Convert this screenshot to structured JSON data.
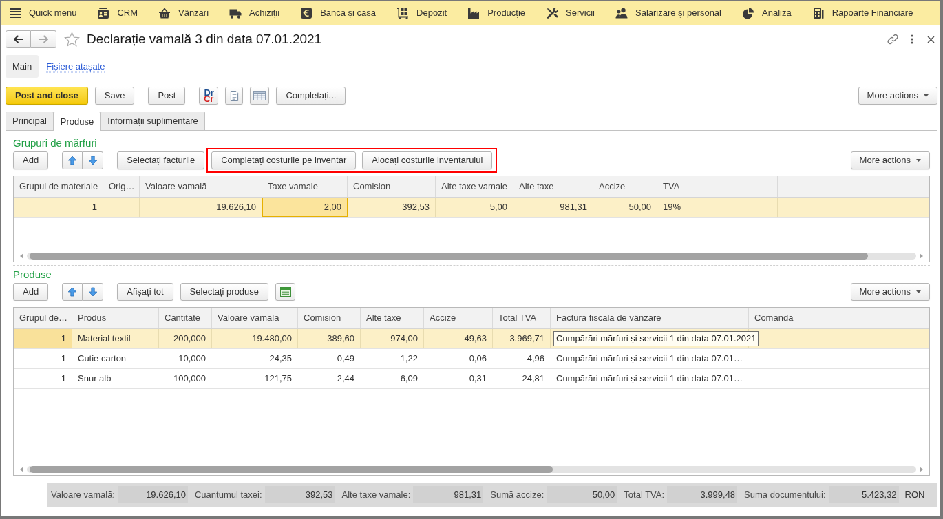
{
  "top_menu": [
    {
      "label": "Quick menu"
    },
    {
      "label": "CRM"
    },
    {
      "label": "Vânzări"
    },
    {
      "label": "Achiziții"
    },
    {
      "label": "Banca și casa"
    },
    {
      "label": "Depozit"
    },
    {
      "label": "Producție"
    },
    {
      "label": "Servicii"
    },
    {
      "label": "Salarizare și personal"
    },
    {
      "label": "Analiză"
    },
    {
      "label": "Rapoarte Financiare"
    }
  ],
  "navigation": [
    {
      "kind": "back",
      "disabled": false
    },
    {
      "kind": "forward",
      "disabled": true
    }
  ],
  "document": {
    "title": "Declarație vamală 3 din data 07.01.2021"
  },
  "view_tabs": [
    {
      "label": "Main",
      "selected": true
    },
    {
      "label": "Fișiere atașate",
      "selected": false
    }
  ],
  "command_bar": {
    "groups": [
      {
        "buttons": [
          {
            "kind": "primary",
            "label": "Post and close"
          },
          {
            "kind": "text",
            "label": "Save"
          }
        ]
      },
      {
        "buttons": [
          {
            "kind": "text",
            "label": "Post"
          }
        ]
      },
      {
        "buttons": [
          {
            "kind": "drcr",
            "lines": [
              "Dr",
              "Cr"
            ]
          },
          {
            "kind": "report"
          },
          {
            "kind": "grid"
          },
          {
            "kind": "text",
            "label": "Completați..."
          }
        ]
      }
    ],
    "more_actions": "More actions"
  },
  "form_tabs": [
    {
      "label": "Principal",
      "selected": false
    },
    {
      "label": "Produse",
      "selected": true
    },
    {
      "label": "Informații suplimentare",
      "selected": false
    }
  ],
  "goods_groups": {
    "heading": "Grupuri de mărfuri",
    "toolbar": {
      "groups": [
        {
          "buttons": [
            {
              "kind": "text",
              "label": "Add"
            }
          ]
        },
        {
          "buttons": [
            {
              "kind": "arrows"
            }
          ]
        },
        {
          "buttons": [
            {
              "kind": "text",
              "label": "Selectați facturile"
            }
          ],
          "highlighted_buttons": [
            {
              "kind": "text",
              "label": "Completați costurile pe inventar"
            },
            {
              "kind": "text",
              "label": "Alocați costurile inventarului"
            }
          ]
        }
      ],
      "more_actions": "More actions"
    },
    "table": {
      "has_focus": true,
      "columns": [
        {
          "label": "Grupul de materiale",
          "kind": "number"
        },
        {
          "label": "Orig…",
          "kind": "text"
        },
        {
          "label": "Valoare vamală",
          "kind": "number"
        },
        {
          "label": "Taxe vamale",
          "kind": "number"
        },
        {
          "label": "Comision",
          "kind": "number"
        },
        {
          "label": "Alte taxe vamale",
          "kind": "number"
        },
        {
          "label": "Alte taxe",
          "kind": "number"
        },
        {
          "label": "Accize",
          "kind": "number"
        },
        {
          "label": "TVA",
          "kind": "text"
        }
      ],
      "rows": [
        {
          "selected": true,
          "cells": [
            {
              "text": "1",
              "focused": false
            },
            {
              "focused": false
            },
            {
              "text": "19.626,10",
              "focused": false
            },
            {
              "text": "2,00",
              "focused": true
            },
            {
              "text": "392,53",
              "focused": false
            },
            {
              "text": "5,00",
              "focused": false
            },
            {
              "text": "981,31",
              "focused": false
            },
            {
              "text": "50,00",
              "focused": false
            },
            {
              "text": "19%",
              "focused": false
            }
          ]
        }
      ]
    }
  },
  "products": {
    "heading": "Produse",
    "toolbar": {
      "groups": [
        {
          "buttons": [
            {
              "kind": "text",
              "label": "Add"
            }
          ]
        },
        {
          "buttons": [
            {
              "kind": "arrows"
            }
          ]
        },
        {
          "buttons": [
            {
              "kind": "text",
              "label": "Afișați tot"
            },
            {
              "kind": "text",
              "label": "Selectați produse"
            },
            {
              "kind": "sheet"
            }
          ]
        }
      ],
      "more_actions": "More actions"
    },
    "table": {
      "has_focus": false,
      "columns": [
        {
          "label": "Grupul de…",
          "kind": "number"
        },
        {
          "label": "Produs",
          "kind": "text"
        },
        {
          "label": "Cantitate",
          "kind": "number"
        },
        {
          "label": "Valoare vamală",
          "kind": "number"
        },
        {
          "label": "Comision",
          "kind": "number"
        },
        {
          "label": "Alte taxe",
          "kind": "number"
        },
        {
          "label": "Accize",
          "kind": "number"
        },
        {
          "label": "Total TVA",
          "kind": "number"
        },
        {
          "label": "Factură fiscală de vânzare",
          "kind": "text"
        },
        {
          "label": "Comandă",
          "kind": "text"
        }
      ],
      "rows": [
        {
          "selected": true,
          "cells": [
            {
              "text": "1",
              "focused": true,
              "expanded": false
            },
            {
              "text": "Material textil",
              "focused": false,
              "expanded": false
            },
            {
              "text": "200,000",
              "focused": false,
              "expanded": false
            },
            {
              "text": "19.480,00",
              "focused": false,
              "expanded": false
            },
            {
              "text": "389,60",
              "focused": false,
              "expanded": false
            },
            {
              "text": "974,00",
              "focused": false,
              "expanded": false
            },
            {
              "text": "49,63",
              "focused": false,
              "expanded": false
            },
            {
              "text": "3.969,71",
              "focused": false,
              "expanded": false
            },
            {
              "text": "Cumpărări mărfuri și servicii 1 din data 07.01.2021",
              "focused": false,
              "expanded": true
            },
            {
              "focused": false,
              "expanded": false
            }
          ]
        },
        {
          "selected": false,
          "cells": [
            {
              "text": "1",
              "focused": false,
              "expanded": false
            },
            {
              "text": "Cutie carton",
              "focused": false,
              "expanded": false
            },
            {
              "text": "10,000",
              "focused": false,
              "expanded": false
            },
            {
              "text": "24,35",
              "focused": false,
              "expanded": false
            },
            {
              "text": "0,49",
              "focused": false,
              "expanded": false
            },
            {
              "text": "1,22",
              "focused": false,
              "expanded": false
            },
            {
              "text": "0,06",
              "focused": false,
              "expanded": false
            },
            {
              "text": "4,96",
              "focused": false,
              "expanded": false
            },
            {
              "text": "Cumpărări mărfuri și servicii 1 din data 07.01…",
              "focused": false,
              "expanded": false
            },
            {
              "focused": false,
              "expanded": false
            }
          ]
        },
        {
          "selected": false,
          "cells": [
            {
              "text": "1",
              "focused": false,
              "expanded": false
            },
            {
              "text": "Snur alb",
              "focused": false,
              "expanded": false
            },
            {
              "text": "100,000",
              "focused": false,
              "expanded": false
            },
            {
              "text": "121,75",
              "focused": false,
              "expanded": false
            },
            {
              "text": "2,44",
              "focused": false,
              "expanded": false
            },
            {
              "text": "6,09",
              "focused": false,
              "expanded": false
            },
            {
              "text": "0,31",
              "focused": false,
              "expanded": false
            },
            {
              "text": "24,81",
              "focused": false,
              "expanded": false
            },
            {
              "text": "Cumpărări mărfuri și servicii 1 din data 07.01…",
              "focused": false,
              "expanded": false
            },
            {
              "focused": false,
              "expanded": false
            }
          ]
        }
      ]
    }
  },
  "totals": {
    "items": [
      {
        "label": "Valoare vamală:",
        "value": "19.626,10"
      },
      {
        "label": "Cuantumul taxei:",
        "value": "392,53"
      },
      {
        "label": "Alte taxe vamale:",
        "value": "981,31"
      },
      {
        "label": "Sumă accize:",
        "value": "50,00"
      },
      {
        "label": "Total TVA:",
        "value": "3.999,48"
      },
      {
        "label": "Suma documentului:",
        "value": "5.423,32"
      }
    ],
    "currency": "RON"
  }
}
